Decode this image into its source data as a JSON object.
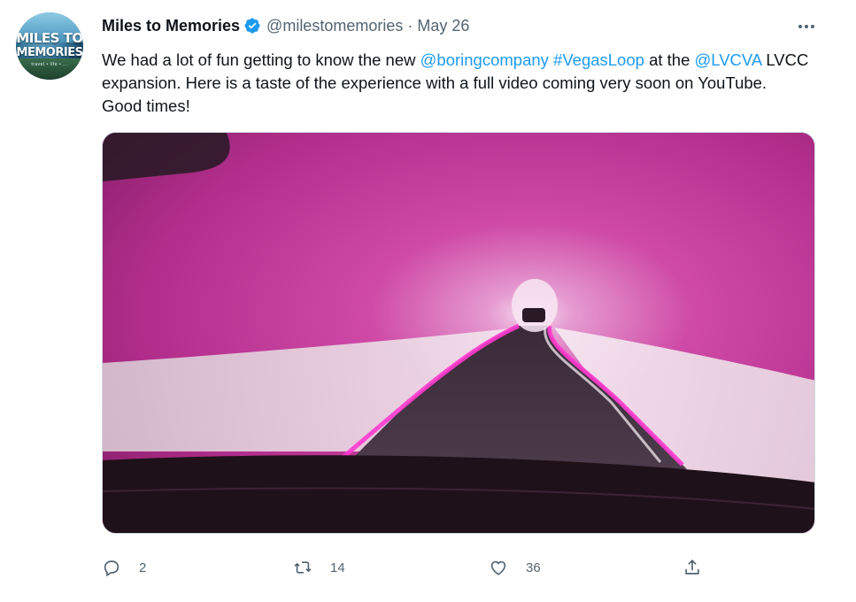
{
  "tweet": {
    "author_name": "Miles to Memories",
    "handle": "@milestomemories",
    "separator": "·",
    "date": "May 26",
    "avatar": {
      "line1": "MILES TO",
      "line2": "MEMORIES",
      "line3": "travel • life • ..."
    },
    "text": {
      "part1": "We had a lot of fun getting to know the new ",
      "mention1": "@boringcompany",
      "space": " ",
      "hashtag1": "#VegasLoop",
      "part2": " at the ",
      "mention2": "@LVCVA",
      "part3": " LVCC expansion. Here is a taste of the experience with a full video coming very soon on YouTube. Good times!"
    },
    "media": {
      "type": "video-still",
      "description_icon": "tunnel-video"
    },
    "actions": {
      "reply_count": "2",
      "retweet_count": "14",
      "like_count": "36"
    }
  },
  "colors": {
    "link": "#1d9bf0",
    "verified": "#1d9bf0",
    "secondary_text": "#536471",
    "tunnel_pink": "#c8328f"
  }
}
